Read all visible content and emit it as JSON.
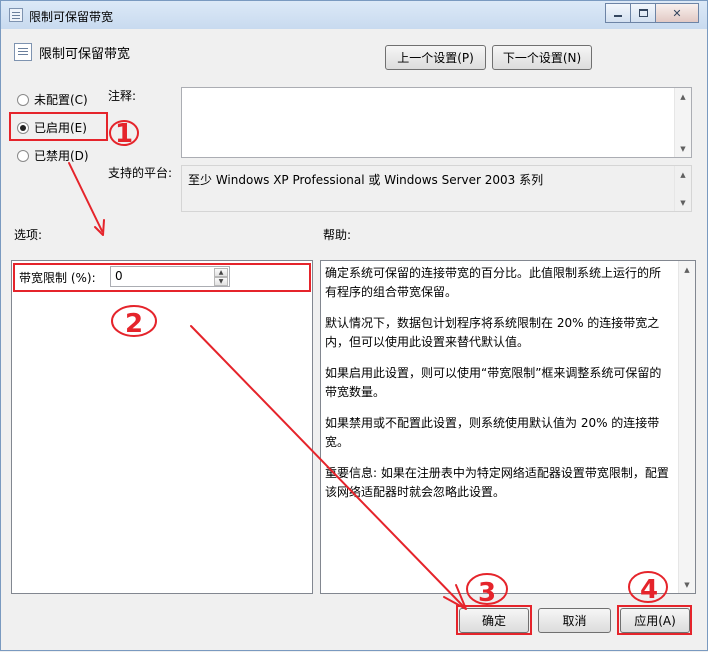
{
  "window": {
    "title": "限制可保留带宽"
  },
  "header": {
    "title": "限制可保留带宽",
    "prev_button": "上一个设置(P)",
    "next_button": "下一个设置(N)"
  },
  "state_options": [
    {
      "label": "未配置(C)",
      "checked": false
    },
    {
      "label": "已启用(E)",
      "checked": true
    },
    {
      "label": "已禁用(D)",
      "checked": false
    }
  ],
  "comment": {
    "label": "注释:",
    "value": ""
  },
  "platform": {
    "label": "支持的平台:",
    "value": "至少 Windows XP Professional 或 Windows Server 2003 系列"
  },
  "options": {
    "label": "选项:",
    "bandwidth_label": "带宽限制 (%):",
    "bandwidth_value": "0"
  },
  "help": {
    "label": "帮助:",
    "paragraphs": [
      "确定系统可保留的连接带宽的百分比。此值限制系统上运行的所有程序的组合带宽保留。",
      "默认情况下，数据包计划程序将系统限制在 20% 的连接带宽之内，但可以使用此设置来替代默认值。",
      "如果启用此设置，则可以使用“带宽限制”框来调整系统可保留的带宽数量。",
      "如果禁用或不配置此设置，则系统使用默认值为 20% 的连接带宽。",
      "重要信息: 如果在注册表中为特定网络适配器设置带宽限制，配置该网络适配器时就会忽略此设置。"
    ]
  },
  "footer": {
    "ok_button": "确定",
    "cancel_button": "取消",
    "apply_button": "应用(A)"
  },
  "annotations": {
    "color": "#e5242b",
    "marks": [
      "1",
      "2",
      "3",
      "4"
    ]
  }
}
